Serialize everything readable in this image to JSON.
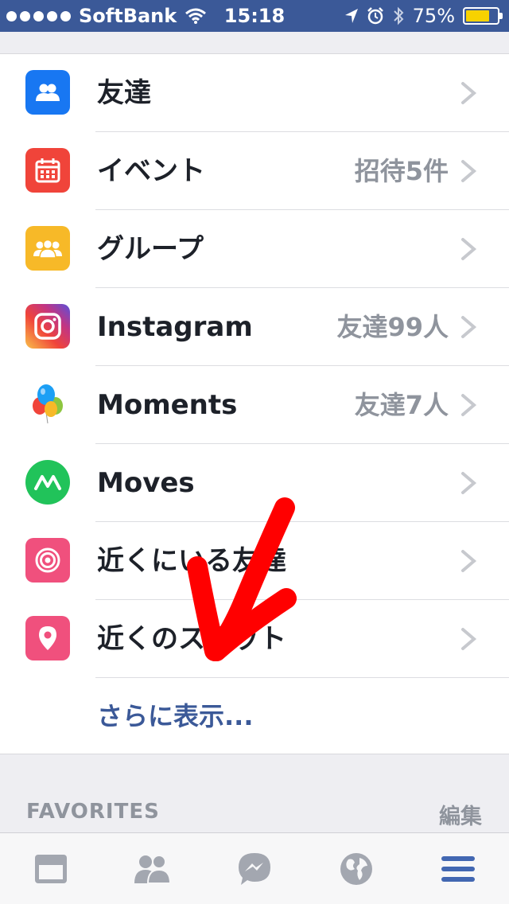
{
  "status_bar": {
    "carrier": "SoftBank",
    "time": "15:18",
    "battery": "75%",
    "battery_level": 0.75,
    "signal_icon": "signal-dots-icon",
    "wifi_icon": "wifi-icon",
    "location_icon": "location-arrow-icon",
    "alarm_icon": "alarm-clock-icon",
    "bluetooth_icon": "bluetooth-icon"
  },
  "menu": {
    "items": [
      {
        "label": "友達",
        "badge": "",
        "icon": "friends-icon",
        "color": "#1877f2"
      },
      {
        "label": "イベント",
        "badge": "招待5件",
        "icon": "calendar-icon",
        "color": "#f0443a"
      },
      {
        "label": "グループ",
        "badge": "",
        "icon": "groups-icon",
        "color": "#f7b928"
      },
      {
        "label": "Instagram",
        "badge": "友達99人",
        "icon": "instagram-icon",
        "color": "#c13584"
      },
      {
        "label": "Moments",
        "badge": "友達7人",
        "icon": "balloons-icon",
        "color": "#1c9ff5"
      },
      {
        "label": "Moves",
        "badge": "",
        "icon": "moves-icon",
        "color": "#21c35a"
      },
      {
        "label": "近くにいる友達",
        "badge": "",
        "icon": "target-icon",
        "color": "#f0507d"
      },
      {
        "label": "近くのスポット",
        "badge": "",
        "icon": "map-pin-icon",
        "color": "#f0507d"
      }
    ],
    "see_more": "さらに表示..."
  },
  "favorites": {
    "title": "FAVORITES",
    "edit": "編集"
  },
  "tab_bar": {
    "tabs": [
      {
        "icon": "news-feed-icon",
        "active": false
      },
      {
        "icon": "friend-requests-icon",
        "active": false
      },
      {
        "icon": "messenger-icon",
        "active": false
      },
      {
        "icon": "globe-notifications-icon",
        "active": false
      },
      {
        "icon": "more-menu-icon",
        "active": true
      }
    ],
    "active_color": "#4267b2",
    "inactive_color": "#a3a7b0"
  },
  "annotation": {
    "color": "#ff0000",
    "icon": "hand-drawn-arrow-icon"
  }
}
